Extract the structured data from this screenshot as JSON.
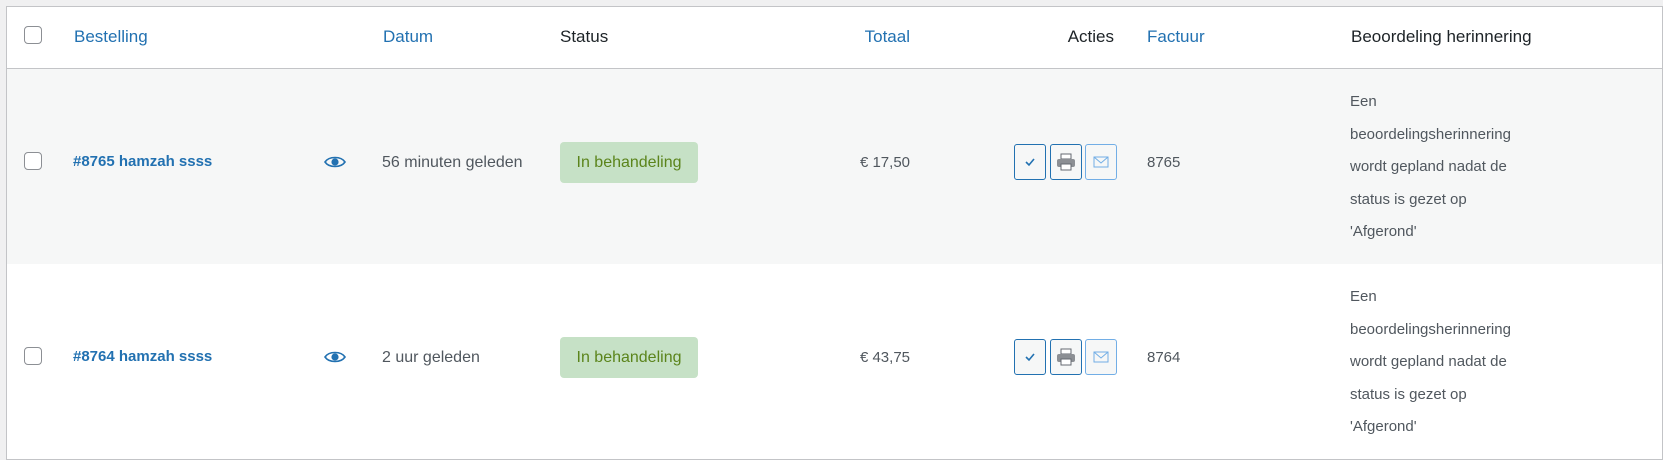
{
  "columns": {
    "order": "Bestelling",
    "date": "Datum",
    "status": "Status",
    "total": "Totaal",
    "actions": "Acties",
    "invoice": "Factuur",
    "review": "Beoordeling herinnering"
  },
  "orders": [
    {
      "title": "#8765 hamzah ssss",
      "date": "56 minuten geleden",
      "status": "In behandeling",
      "total": "€ 17,50",
      "invoice": "8765",
      "review": "Een beoordelingsherinnering wordt gepland nadat de status is gezet op 'Afgerond'"
    },
    {
      "title": "#8764 hamzah ssss",
      "date": "2 uur geleden",
      "status": "In behandeling",
      "total": "€ 43,75",
      "invoice": "8764",
      "review": "Een beoordelingsherinnering wordt gepland nadat de status is gezet op 'Afgerond'"
    }
  ],
  "icons": {
    "preview": "eye-icon",
    "complete": "checkmark-icon",
    "print": "printer-icon",
    "email": "envelope-icon"
  },
  "colors": {
    "link": "#2271b1",
    "status_processing_bg": "#c6e1c6",
    "status_processing_text": "#5b841b",
    "alt_row": "#f6f7f7"
  }
}
